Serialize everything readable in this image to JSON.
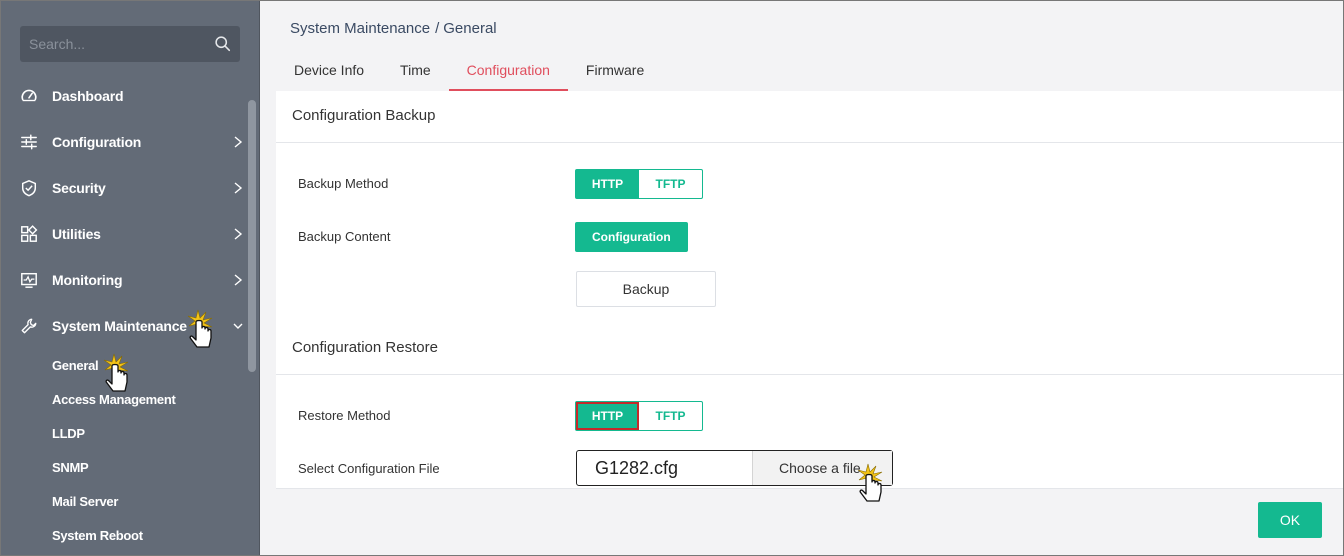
{
  "sidebar": {
    "search_placeholder": "Search...",
    "search_icon": "search-icon",
    "items": [
      {
        "label": "Dashboard",
        "icon": "dashboard-icon",
        "has_chevron": false
      },
      {
        "label": "Configuration",
        "icon": "sliders-icon",
        "has_chevron": true
      },
      {
        "label": "Security",
        "icon": "shield-icon",
        "has_chevron": true
      },
      {
        "label": "Utilities",
        "icon": "apps-icon",
        "has_chevron": true
      },
      {
        "label": "Monitoring",
        "icon": "monitor-icon",
        "has_chevron": true
      },
      {
        "label": "System Maintenance",
        "icon": "wrench-icon",
        "has_chevron": true,
        "expanded": true
      }
    ],
    "sub_items": [
      "General",
      "Access Management",
      "LLDP",
      "SNMP",
      "Mail Server",
      "System Reboot"
    ]
  },
  "breadcrumb": {
    "parent": "System Maintenance",
    "separator": "/",
    "current": "General"
  },
  "tabs": [
    {
      "label": "Device Info",
      "active": false
    },
    {
      "label": "Time",
      "active": false
    },
    {
      "label": "Configuration",
      "active": true
    },
    {
      "label": "Firmware",
      "active": false
    }
  ],
  "backup": {
    "title": "Configuration Backup",
    "method_label": "Backup Method",
    "method_options": [
      "HTTP",
      "TFTP"
    ],
    "method_selected": "HTTP",
    "content_label": "Backup Content",
    "content_value": "Configuration",
    "button": "Backup"
  },
  "restore": {
    "title": "Configuration Restore",
    "method_label": "Restore Method",
    "method_options": [
      "HTTP",
      "TFTP"
    ],
    "method_selected": "HTTP",
    "file_label": "Select Configuration File",
    "file_name": "G1282.cfg",
    "file_button": "Choose a file"
  },
  "footer": {
    "ok_label": "OK"
  },
  "colors": {
    "accent": "#14b990",
    "tab_active": "#e04e5d",
    "sidebar_bg": "#636b77",
    "highlight_border": "#c42a2a"
  }
}
